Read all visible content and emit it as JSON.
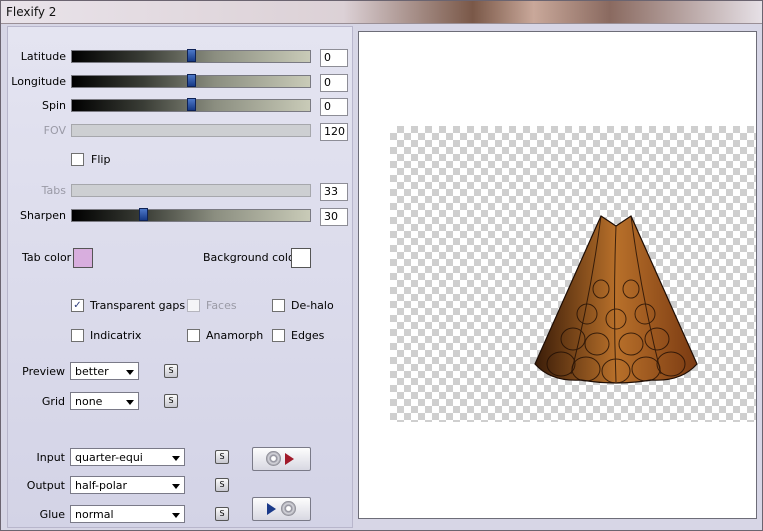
{
  "window": {
    "title": "Flexify 2"
  },
  "sliders": [
    {
      "label": "Latitude",
      "value": "0",
      "level": 0.5,
      "enabled": true
    },
    {
      "label": "Longitude",
      "value": "0",
      "level": 0.5,
      "enabled": true
    },
    {
      "label": "Spin",
      "value": "0",
      "level": 0.5,
      "enabled": true
    },
    {
      "label": "FOV",
      "value": "120",
      "enabled": false
    },
    {
      "label": "Tabs",
      "value": "33",
      "enabled": false
    },
    {
      "label": "Sharpen",
      "value": "30",
      "level": 0.3,
      "enabled": true
    }
  ],
  "flip": {
    "label": "Flip",
    "checked": false
  },
  "colors": {
    "tab_color_label": "Tab color",
    "tab_color": "#d8aede",
    "background_color_label": "Background color",
    "background_color": "#ffffff"
  },
  "options": {
    "transparent_gaps": {
      "label": "Transparent gaps",
      "checked": true
    },
    "faces": {
      "label": "Faces",
      "checked": false,
      "enabled": false
    },
    "de_halo": {
      "label": "De-halo",
      "checked": false
    },
    "indicatrix": {
      "label": "Indicatrix",
      "checked": false
    },
    "anamorph": {
      "label": "Anamorph",
      "checked": false
    },
    "edges": {
      "label": "Edges",
      "checked": false
    }
  },
  "preview": {
    "label": "Preview",
    "value": "better"
  },
  "grid": {
    "label": "Grid",
    "value": "none"
  },
  "input": {
    "label": "Input",
    "value": "quarter-equi"
  },
  "output": {
    "label": "Output",
    "value": "half-polar"
  },
  "glue": {
    "label": "Glue",
    "value": "normal"
  },
  "small_button_glyph": "S",
  "checkmark": "✓",
  "accent_colors": {
    "shape_dark": "#3a1c08",
    "shape_mid": "#7a3a12",
    "shape_light": "#b8702a"
  }
}
